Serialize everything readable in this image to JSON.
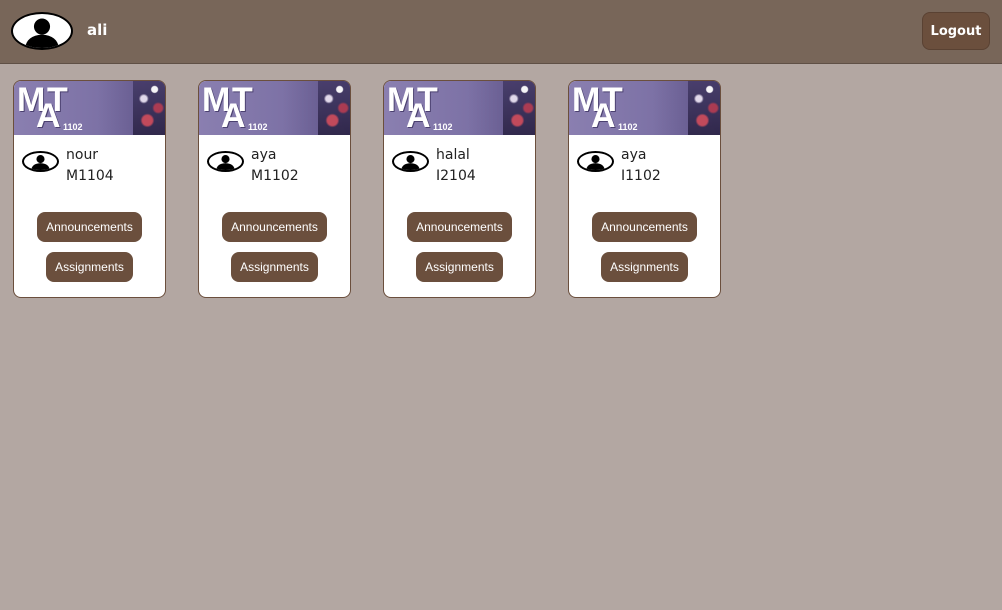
{
  "header": {
    "user_name": "ali",
    "logout_label": "Logout"
  },
  "course_logo": {
    "letters": [
      "M",
      "A",
      "T"
    ],
    "number": "1102"
  },
  "colors": {
    "header_bg": "#786659",
    "page_bg": "#b3a7a2",
    "button_bg": "#6b4f3d",
    "button_text": "#ffffff"
  },
  "icons": {
    "user_avatar": "person-silhouette-icon",
    "teacher_avatar": "person-silhouette-icon"
  },
  "cards": [
    {
      "teacher": "nour",
      "code": "M1104",
      "announcements_label": "Announcements",
      "assignments_label": "Assignments"
    },
    {
      "teacher": "aya",
      "code": "M1102",
      "announcements_label": "Announcements",
      "assignments_label": "Assignments"
    },
    {
      "teacher": "halal",
      "code": "I2104",
      "announcements_label": "Announcements",
      "assignments_label": "Assignments"
    },
    {
      "teacher": "aya",
      "code": "I1102",
      "announcements_label": "Announcements",
      "assignments_label": "Assignments"
    }
  ]
}
